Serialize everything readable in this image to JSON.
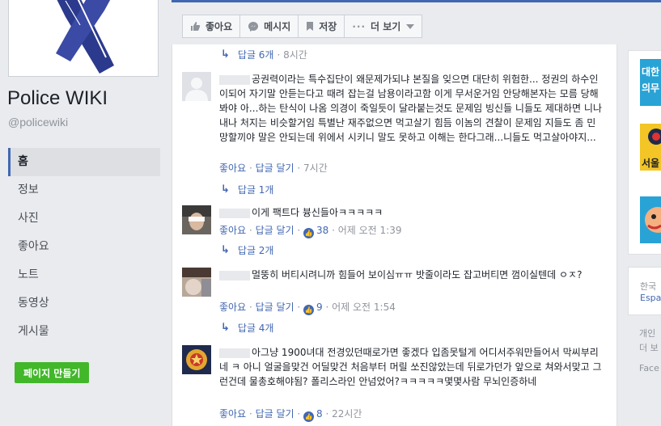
{
  "page": {
    "name": "Police WIKI",
    "handle": "@policewiki"
  },
  "nav": {
    "items": [
      "홈",
      "정보",
      "사진",
      "좋아요",
      "노트",
      "동영상",
      "게시물"
    ],
    "create_page": "페이지 만들기"
  },
  "actions": {
    "like": "좋아요",
    "message": "메시지",
    "save": "저장",
    "more": "더 보기"
  },
  "feed": {
    "top_reply": {
      "label": "답글 6개",
      "time": "8시간"
    },
    "comments": [
      {
        "text": "공권력이라는 특수집단이 왜문제가되냐 본질을 잊으면 대단히 위험한... 정권의 하수인이되어 자기말 안듣는다고 때려 잡는걸 남용이라고함 이게 무서운거임 안당해본자는 모름 당해봐야 아...하는 탄식이 나옴 의경이 죽일듯이 달라붙는것도 문제임 빙신들 니들도 제대하면 니나 내나 처지는 비슷할거임 특별난 재주없으면 먹고살기 힘듬 이놈의 견찰이 문제임 지들도 좀 민망할끼야 말은 안되는데 위에서 시키니 말도 못하고 이해는 한다그래...니들도 먹고살아야지...",
        "like": "좋아요",
        "reply": "답글 달기",
        "time": "7시간",
        "reactions": "",
        "reply_count": "답글 1개"
      },
      {
        "text": "이게 팩트다 븅신들아ㅋㅋㅋㅋㅋ",
        "like": "좋아요",
        "reply": "답글 달기",
        "time": "어제 오전 1:39",
        "reactions": "38",
        "reply_count": "답글 2개"
      },
      {
        "text": "멀뚱히 버티시려니까 힘들어 보이심ㅠㅠ 밧줄이라도 잡고버티면 껌이실텐데 ㅇㅈ?",
        "like": "좋아요",
        "reply": "답글 달기",
        "time": "어제 오전 1:54",
        "reactions": "9",
        "reply_count": "답글 4개"
      },
      {
        "text": "아그냥 1900녀대 전경있던때로가면 좋겠다 입좀못털게 어디서주워만들어서 막씨부리네 ㅋ 아니 얼굴을맞건 어딜맞건 처음부터 머릴 쏘진않았는데 뒤로가던가 앞으로 쳐와서맞고 그런건데 물총호해야됨? 폴리스라인 안넘었어?ㅋㅋㅋㅋㅋ몇몇사람 무뇌인증하네",
        "like": "좋아요",
        "reply": "답글 달기",
        "time": "22시간",
        "reactions": "8",
        "reply_count": ""
      }
    ]
  },
  "right": {
    "snippet1": "대한",
    "snippet2": "의무",
    "snippet3": "서울",
    "lang1": "한국",
    "lang2": "Espa",
    "foot1": "개인",
    "foot2": "더 보",
    "foot3": "Face"
  },
  "colors": {
    "brand": "#4267b2",
    "green": "#42b72a",
    "bg": "#e9ebee"
  }
}
